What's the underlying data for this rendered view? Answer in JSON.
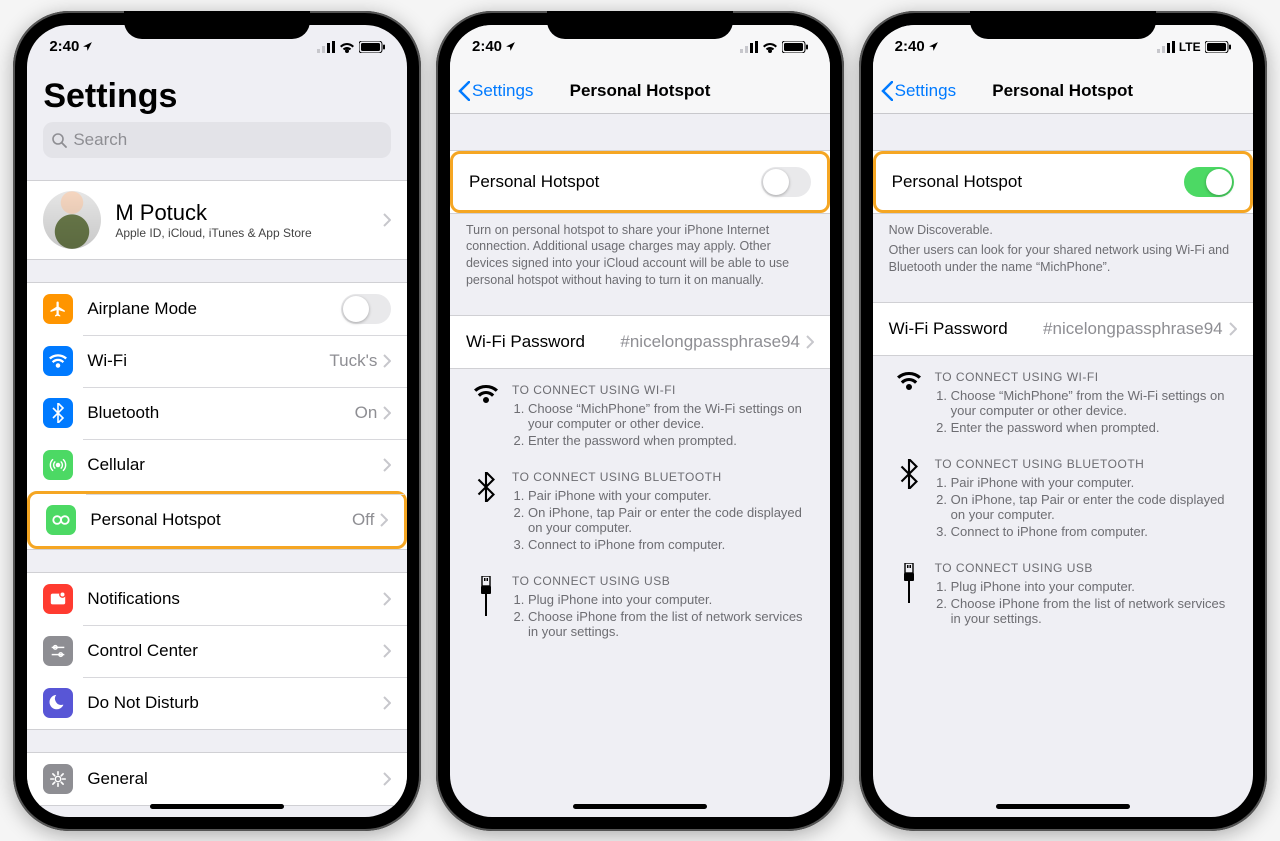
{
  "status": {
    "time": "2:40"
  },
  "phone1": {
    "title": "Settings",
    "search_placeholder": "Search",
    "profile": {
      "name": "M Potuck",
      "sub": "Apple ID, iCloud, iTunes & App Store"
    },
    "rows": {
      "airplane": "Airplane Mode",
      "wifi": "Wi-Fi",
      "wifi_val": "Tuck's",
      "bt": "Bluetooth",
      "bt_val": "On",
      "cell": "Cellular",
      "hotspot": "Personal Hotspot",
      "hotspot_val": "Off",
      "notif": "Notifications",
      "cc": "Control Center",
      "dnd": "Do Not Disturb",
      "gen": "General"
    }
  },
  "phone2": {
    "back": "Settings",
    "title": "Personal Hotspot",
    "row_label": "Personal Hotspot",
    "footer1": "Turn on personal hotspot to share your iPhone Internet connection. Additional usage charges may apply. Other devices signed into your iCloud account will be able to use personal hotspot without having to turn it on manually.",
    "wifi_pass_label": "Wi-Fi Password",
    "wifi_pass_value": "#nicelongpassphrase94",
    "instr_wifi_title": "TO CONNECT USING WI-FI",
    "instr_wifi_1": "Choose “MichPhone” from the Wi-Fi settings on your computer or other device.",
    "instr_wifi_2": "Enter the password when prompted.",
    "instr_bt_title": "TO CONNECT USING BLUETOOTH",
    "instr_bt_1": "Pair iPhone with your computer.",
    "instr_bt_2": "On iPhone, tap Pair or enter the code displayed on your computer.",
    "instr_bt_3": "Connect to iPhone from computer.",
    "instr_usb_title": "TO CONNECT USING USB",
    "instr_usb_1": "Plug iPhone into your computer.",
    "instr_usb_2": "Choose iPhone from the list of network services in your settings."
  },
  "phone3": {
    "back": "Settings",
    "title": "Personal Hotspot",
    "row_label": "Personal Hotspot",
    "footer1a": "Now Discoverable.",
    "footer1b": "Other users can look for your shared network using Wi-Fi and Bluetooth under the name “MichPhone”.",
    "wifi_pass_label": "Wi-Fi Password",
    "wifi_pass_value": "#nicelongpassphrase94",
    "instr_wifi_title": "TO CONNECT USING WI-FI",
    "instr_wifi_1": "Choose “MichPhone” from the Wi-Fi settings on your computer or other device.",
    "instr_wifi_2": "Enter the password when prompted.",
    "instr_bt_title": "TO CONNECT USING BLUETOOTH",
    "instr_bt_1": "Pair iPhone with your computer.",
    "instr_bt_2": "On iPhone, tap Pair or enter the code displayed on your computer.",
    "instr_bt_3": "Connect to iPhone from computer.",
    "instr_usb_title": "TO CONNECT USING USB",
    "instr_usb_1": "Plug iPhone into your computer.",
    "instr_usb_2": "Choose iPhone from the list of network services in your settings."
  }
}
